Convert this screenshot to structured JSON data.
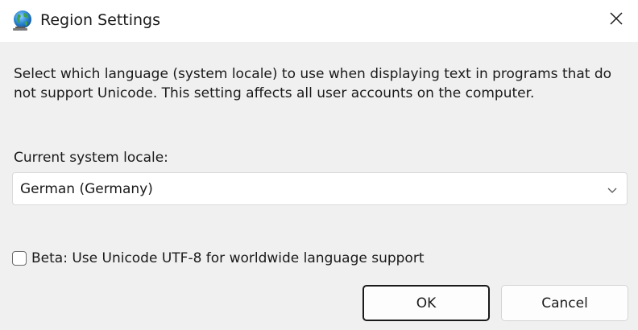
{
  "window": {
    "title": "Region Settings",
    "close_icon": "close-icon",
    "app_icon": "globe-icon"
  },
  "content": {
    "description": "Select which language (system locale) to use when displaying text in programs that do not support Unicode. This setting affects all user accounts on the computer.",
    "locale_label": "Current system locale:",
    "locale_value": "German (Germany)",
    "beta_checkbox": {
      "label": "Beta: Use Unicode UTF-8 for worldwide language support",
      "checked": false
    }
  },
  "buttons": {
    "ok_label": "OK",
    "cancel_label": "Cancel"
  },
  "colors": {
    "titlebar": "#ffffff",
    "body": "#f0f0f0",
    "default_button_border": "#1a1a1a"
  }
}
